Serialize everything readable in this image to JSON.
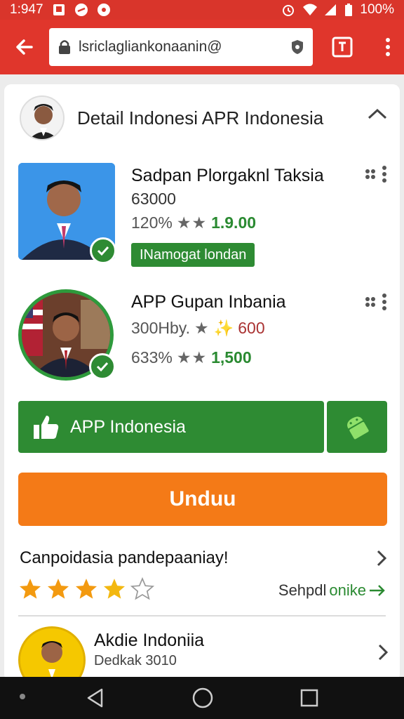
{
  "status_bar": {
    "time": "1:947",
    "battery": "100%"
  },
  "browser": {
    "url": "lsriclagliankonaanin@"
  },
  "header": {
    "title": "Detail Indonesi APR Indonesia"
  },
  "apps": [
    {
      "title": "Sadpan Plorgaknl Taksia",
      "subtitle": "63000",
      "meta_prefix": "120%",
      "meta_value": "1.9.00",
      "tag": "INamogat londan"
    },
    {
      "title": "APP Gupan Inbania",
      "meta1_prefix": "300Hby.",
      "meta1_value": "600",
      "meta2_prefix": "633%",
      "meta2_value": "1,500"
    }
  ],
  "actions": {
    "main_label": "APP Indonesia",
    "download_label": "Unduu"
  },
  "rating": {
    "title": "Canpoidasia pandepaaniay!",
    "stars": 3.5,
    "link_prefix": "Sehpdl",
    "link_suffix": "onike"
  },
  "related": {
    "title": "Akdie Indoniia",
    "subtitle": "Dedkak 3010"
  },
  "colors": {
    "brand_red": "#e0362c",
    "green": "#2e8b33",
    "orange": "#f47a17",
    "star": "#f39a10"
  }
}
